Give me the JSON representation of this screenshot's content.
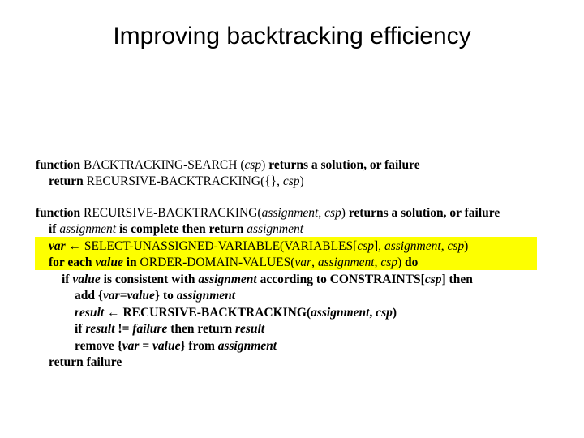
{
  "title": "Improving backtracking efficiency",
  "code": {
    "l1a": "function",
    "l1b": " BACKTRACKING-SEARCH (",
    "l1c": "csp",
    "l1d": ") ",
    "l1e": "returns",
    "l1f": " a solution, or failure",
    "l2a": "return",
    "l2b": " RECURSIVE-BACKTRACKING({}, ",
    "l2c": "csp",
    "l2d": ")",
    "l3a": "function",
    "l3b": " RECURSIVE-BACKTRACKING(",
    "l3c": "assignment",
    "l3d": ", ",
    "l3e": "csp",
    "l3f": ") ",
    "l3g": "returns",
    "l3h": " a solution, or failure",
    "l4a": "if ",
    "l4b": "assignment",
    "l4c": " is complete ",
    "l4d": "then return ",
    "l4e": "assignment",
    "l5a": "var",
    "l5b": " ",
    "l5arrow": "←",
    "l5c": " SELECT-UNASSIGNED-VARIABLE(VARIABLES[",
    "l5d": "csp",
    "l5e": "], ",
    "l5f": "assignment",
    "l5g": ", ",
    "l5h": "csp",
    "l5i": ")",
    "l6a": "for each ",
    "l6b": "value",
    "l6c": " in",
    "l6d": " ORDER-DOMAIN-VALUES(",
    "l6e": "var",
    "l6f": ", ",
    "l6g": "assignment",
    "l6h": ", ",
    "l6i": "csp",
    "l6j": ") ",
    "l6k": "do",
    "l7a": "if ",
    "l7b": "value",
    "l7c": " is consistent with ",
    "l7d": "assignment",
    "l7e": " according to CONSTRAINTS[",
    "l7f": "csp",
    "l7g": "] ",
    "l7h": "then",
    "l8a": "add {",
    "l8b": "var=value",
    "l8c": "} to ",
    "l8d": "assignment",
    "l9a": "result",
    "l9b": " ",
    "l9arrow": "←",
    "l9c": " RECURSIVE-BACKTRACKING(",
    "l9d": "assignment",
    "l9e": ", ",
    "l9f": "csp",
    "l9g": ")",
    "l10a": "if ",
    "l10b": "result",
    "l10c": " != ",
    "l10d": "failure",
    "l10e": " then return ",
    "l10f": "result",
    "l11a": "remove {",
    "l11b": "var = value",
    "l11c": "} from ",
    "l11d": "assignment",
    "l12a": "return",
    "l12b": " failure"
  }
}
